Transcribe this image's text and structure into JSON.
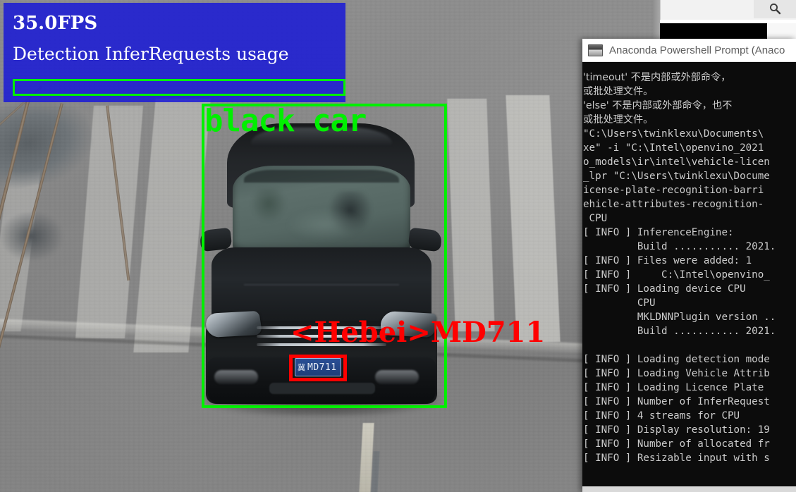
{
  "scene": {
    "description": "traffic-camera-still",
    "car_color_label": "black car",
    "plate_text_cn": "冀",
    "plate_text_num": "MD711"
  },
  "stats_overlay": {
    "fps": "35.0FPS",
    "caption": "Detection InferRequests usage",
    "bar_fill_percent": 0,
    "panel_color": "#1a1ad6",
    "bar_border_color": "#00f000"
  },
  "annotations": {
    "vehicle_label": "black car",
    "vehicle_box_color": "#00f000",
    "plate_label": "<Hebei>MD711",
    "plate_box_color": "#ff0000"
  },
  "background_window": {
    "search_icon": "search-icon"
  },
  "terminal": {
    "title": "Anaconda Powershell Prompt (Anaco",
    "icon": "console-icon",
    "lines": [
      "'timeout' 不是内部或外部命令，",
      "或批处理文件。",
      "'else' 不是内部或外部命令，也不",
      "或批处理文件。",
      "\"C:\\Users\\twinklexu\\Documents\\",
      "xe\" -i \"C:\\Intel\\openvino_2021",
      "o_models\\ir\\intel\\vehicle-licen",
      "_lpr \"C:\\Users\\twinklexu\\Docume",
      "icense-plate-recognition-barri",
      "ehicle-attributes-recognition-",
      " CPU",
      "[ INFO ] InferenceEngine:",
      "         Build ........... 2021.",
      "[ INFO ] Files were added: 1",
      "[ INFO ]     C:\\Intel\\openvino_",
      "[ INFO ] Loading device CPU",
      "         CPU",
      "         MKLDNNPlugin version ..",
      "         Build ........... 2021.",
      "",
      "[ INFO ] Loading detection mode",
      "[ INFO ] Loading Vehicle Attrib",
      "[ INFO ] Loading Licence Plate",
      "[ INFO ] Number of InferRequest",
      "[ INFO ] 4 streams for CPU",
      "[ INFO ] Display resolution: 19",
      "[ INFO ] Number of allocated fr",
      "[ INFO ] Resizable input with s"
    ]
  }
}
